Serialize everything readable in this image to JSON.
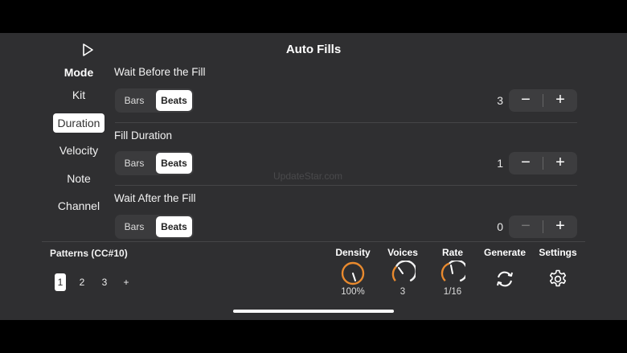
{
  "header": {
    "title": "Auto Fills",
    "play": "play-icon"
  },
  "mode": {
    "heading": "Mode",
    "items": [
      {
        "label": "Kit",
        "selected": false
      },
      {
        "label": "Duration",
        "selected": true
      },
      {
        "label": "Velocity",
        "selected": false
      },
      {
        "label": "Note",
        "selected": false
      },
      {
        "label": "Channel",
        "selected": false
      }
    ]
  },
  "sections": [
    {
      "title": "Wait Before the Fill",
      "opt_a": "Bars",
      "opt_b": "Beats",
      "selected": "Beats",
      "value": "3",
      "minus": "−",
      "plus": "+"
    },
    {
      "title": "Fill Duration",
      "opt_a": "Bars",
      "opt_b": "Beats",
      "selected": "Beats",
      "value": "1",
      "minus": "−",
      "plus": "+"
    },
    {
      "title": "Wait After the Fill",
      "opt_a": "Bars",
      "opt_b": "Beats",
      "selected": "Beats",
      "value": "0",
      "minus": "−",
      "plus": "+"
    }
  ],
  "watermark": "UpdateStar.com",
  "patterns": {
    "title": "Patterns (CC#10)",
    "items": [
      "1",
      "2",
      "3",
      "+"
    ],
    "selected": "1"
  },
  "controls": {
    "density": {
      "label": "Density",
      "value": "100%",
      "level": 1.0,
      "color": "#e98a2e"
    },
    "voices": {
      "label": "Voices",
      "value": "3",
      "color": "#e98a2e"
    },
    "rate": {
      "label": "Rate",
      "value": "1/16",
      "color": "#e98a2e"
    },
    "generate": {
      "label": "Generate",
      "icon": "refresh-icon"
    },
    "settings": {
      "label": "Settings",
      "icon": "gear-icon"
    }
  }
}
